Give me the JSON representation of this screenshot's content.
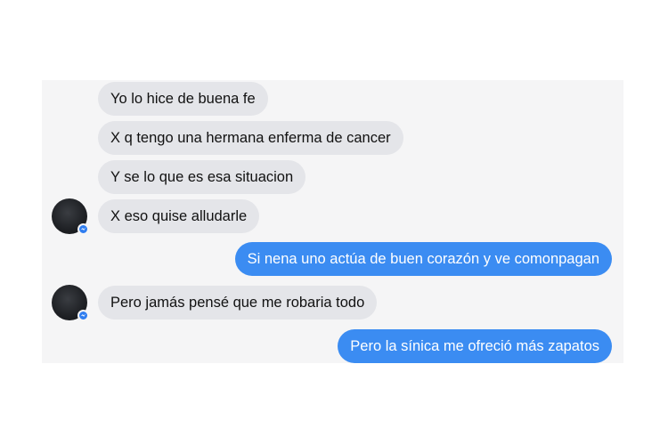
{
  "conversation": {
    "messages": [
      {
        "direction": "incoming",
        "text": "Yo lo hice de buena fe"
      },
      {
        "direction": "incoming",
        "text": "X q tengo una hermana enferma de cancer"
      },
      {
        "direction": "incoming",
        "text": "Y se lo que es esa situacion"
      },
      {
        "direction": "incoming",
        "text": "X eso quise alludarle"
      },
      {
        "direction": "outgoing",
        "text": "Si nena uno actúa de buen corazón y ve comonpagan"
      },
      {
        "direction": "incoming",
        "text": "Pero jamás pensé que me robaria todo"
      },
      {
        "direction": "outgoing",
        "text": "Pero la sínica me ofreció más zapatos"
      }
    ]
  },
  "colors": {
    "incoming_bubble": "#e4e5e9",
    "outgoing_bubble": "#3b8cf2",
    "panel_background": "#f5f5f6",
    "messenger_badge": "#2f7df0"
  },
  "icons": {
    "avatar": "contact-avatar",
    "badge": "messenger-badge-icon"
  }
}
